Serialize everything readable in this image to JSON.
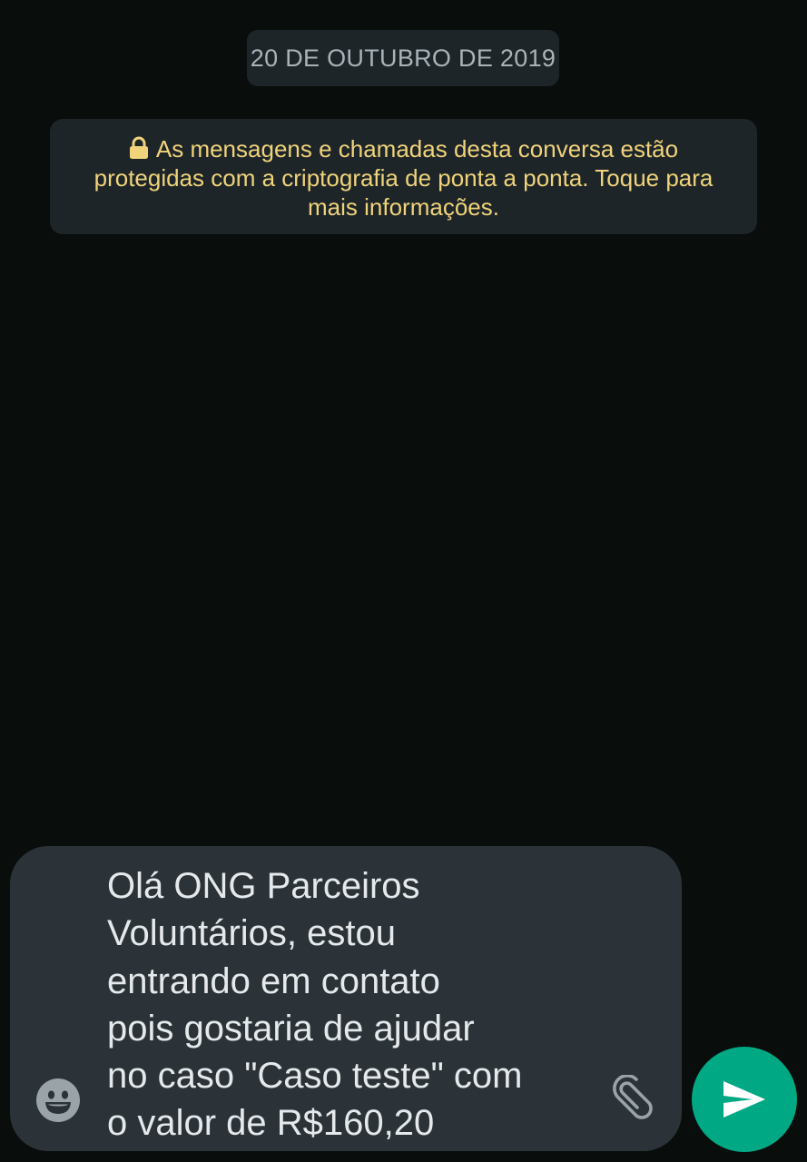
{
  "chat": {
    "date_chip": "20 DE OUTUBRO DE 2019",
    "encryption_notice": "As mensagens e chamadas desta conversa estão protegidas com a criptografia de ponta a ponta. Toque para mais informações."
  },
  "composer": {
    "message_text": "Olá ONG Parceiros\nVoluntários, estou\nentrando em contato\npois gostaria de ajudar\nno caso \"Caso teste\" com\no valor de R$160,20",
    "emoji_icon": "emoji-icon",
    "attach_icon": "paperclip-icon",
    "send_icon": "send-icon"
  },
  "colors": {
    "background": "#090d0b",
    "bubble": "#1d2529",
    "notice_text": "#f0d37a",
    "composer": "#2b3338",
    "send_button": "#00a884"
  }
}
